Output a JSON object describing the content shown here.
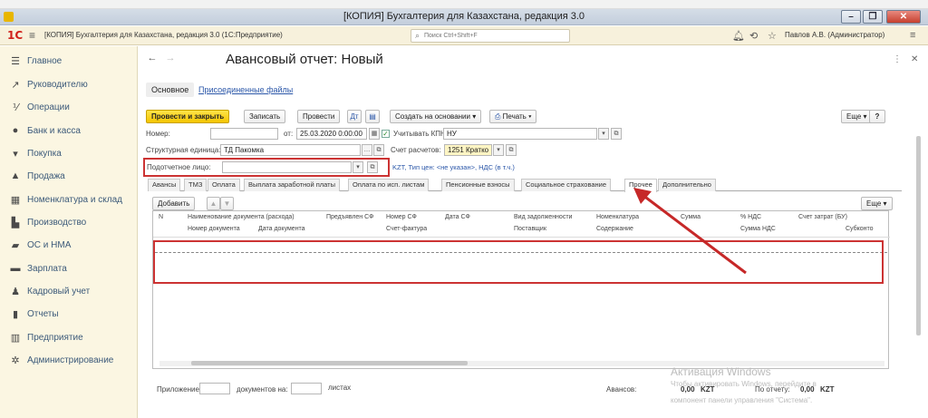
{
  "window": {
    "title": "[КОПИЯ] Бухгалтерия для Казахстана, редакция 3.0"
  },
  "appbar": {
    "logo": "1С",
    "title": "[КОПИЯ] Бухгалтерия для Казахстана, редакция 3.0 (1С:Предприятие)",
    "search_placeholder": "Поиск Ctrl+Shift+F",
    "user": "Павлов А.В. (Администратор)"
  },
  "sidebar": {
    "items": [
      {
        "label": "Главное",
        "icon": "menu-icon"
      },
      {
        "label": "Руководителю",
        "icon": "trend-icon"
      },
      {
        "label": "Операции",
        "icon": "operations-icon"
      },
      {
        "label": "Банк и касса",
        "icon": "bank-icon"
      },
      {
        "label": "Покупка",
        "icon": "cart-icon"
      },
      {
        "label": "Продажа",
        "icon": "bag-icon"
      },
      {
        "label": "Номенклатура и склад",
        "icon": "warehouse-icon"
      },
      {
        "label": "Производство",
        "icon": "factory-icon"
      },
      {
        "label": "ОС и НМА",
        "icon": "truck-icon"
      },
      {
        "label": "Зарплата",
        "icon": "money-icon"
      },
      {
        "label": "Кадровый учет",
        "icon": "people-icon"
      },
      {
        "label": "Отчеты",
        "icon": "chart-icon"
      },
      {
        "label": "Предприятие",
        "icon": "building-icon"
      },
      {
        "label": "Администрирование",
        "icon": "gear-icon"
      }
    ]
  },
  "document": {
    "title": "Авансовый отчет: Новый",
    "tabs": [
      "Основное",
      "Присоединенные файлы"
    ],
    "toolbar": {
      "post_close": "Провести и закрыть",
      "save": "Записать",
      "post": "Провести",
      "create_based": "Создать на основании",
      "print": "Печать",
      "more": "Еще",
      "help": "?"
    },
    "fields": {
      "number_label": "Номер:",
      "number_value": "",
      "date_prefix": "от:",
      "date_value": "25.03.2020 0:00:00",
      "kpn_label": "Учитывать КПН",
      "kpn_value": "НУ",
      "unit_label": "Структурная единица:",
      "unit_value": "ТД Пакомка",
      "account_label": "Счет расчетов:",
      "account_value": "1251 Кратко",
      "person_label": "Подотчетное лицо:",
      "person_value": "",
      "currency_link": "KZT, Тип цен: <не указан>, НДС (в т.ч.)"
    },
    "section_tabs": [
      "Авансы",
      "ТМЗ",
      "Оплата",
      "Выплата заработной платы",
      "Оплата по исп. листам",
      "Пенсионные взносы",
      "Социальное страхование",
      "Прочее",
      "Дополнительно"
    ],
    "active_section_tab": "Прочее",
    "grid": {
      "add_label": "Добавить",
      "more_label": "Еще",
      "headers_row1": [
        "N",
        "Наименование документа (расхода)",
        "Предъявлен СФ",
        "Номер СФ",
        "Дата СФ",
        "Вид задолженности",
        "Номенклатура",
        "Сумма",
        "% НДС",
        "Счет затрат (БУ)"
      ],
      "headers_row2": [
        "Номер документа",
        "Дата документа",
        "Счет-фактура",
        "Поставщик",
        "Содержание",
        "Сумма НДС",
        "Субконто"
      ]
    },
    "footer": {
      "attachment_label": "Приложение:",
      "docs_label": "документов на:",
      "sheets_label": "листах",
      "advances_label": "Авансов:",
      "advances_value": "0,00",
      "advances_currency": "KZT",
      "reported_label": "По отчету:",
      "reported_value": "0,00",
      "reported_currency": "KZT"
    }
  },
  "watermark": {
    "line1": "Активация Windows",
    "line2": "Чтобы активировать Windows, перейдите в",
    "line3": "компонент панели управления \"Система\"."
  },
  "colors": {
    "accent": "#f4c500",
    "annotation": "#cc3333",
    "link": "#2a56a8",
    "sidebar_bg": "#fbf6e2"
  }
}
